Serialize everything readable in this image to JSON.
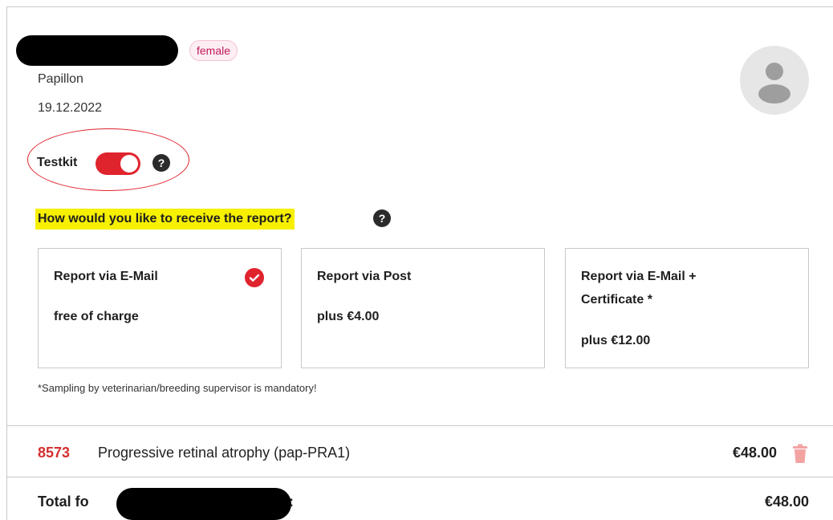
{
  "animal": {
    "gender": "female",
    "breed": "Papillon",
    "date": "19.12.2022"
  },
  "testkit": {
    "label": "Testkit",
    "enabled": true,
    "help": "?"
  },
  "report": {
    "question": "How would you like to receive the report?",
    "help": "?",
    "options": [
      {
        "title": "Report via E-Mail",
        "price": "free of charge",
        "selected": true
      },
      {
        "title": "Report via Post",
        "price": "plus €4.00",
        "selected": false
      },
      {
        "title": "Report via E-Mail + Certificate *",
        "price": "plus €12.00",
        "selected": false
      }
    ],
    "footnote": "*Sampling by veterinarian/breeding supervisor is mandatory!"
  },
  "tests": [
    {
      "code": "8573",
      "name": "Progressive retinal atrophy (pap-PRA1)",
      "price": "€48.00"
    }
  ],
  "total": {
    "label": "Total fo",
    "colon": ":",
    "price": "€48.00"
  },
  "colors": {
    "accent": "#e0242e",
    "highlight": "#f7f000",
    "badge_text": "#c2185b"
  }
}
